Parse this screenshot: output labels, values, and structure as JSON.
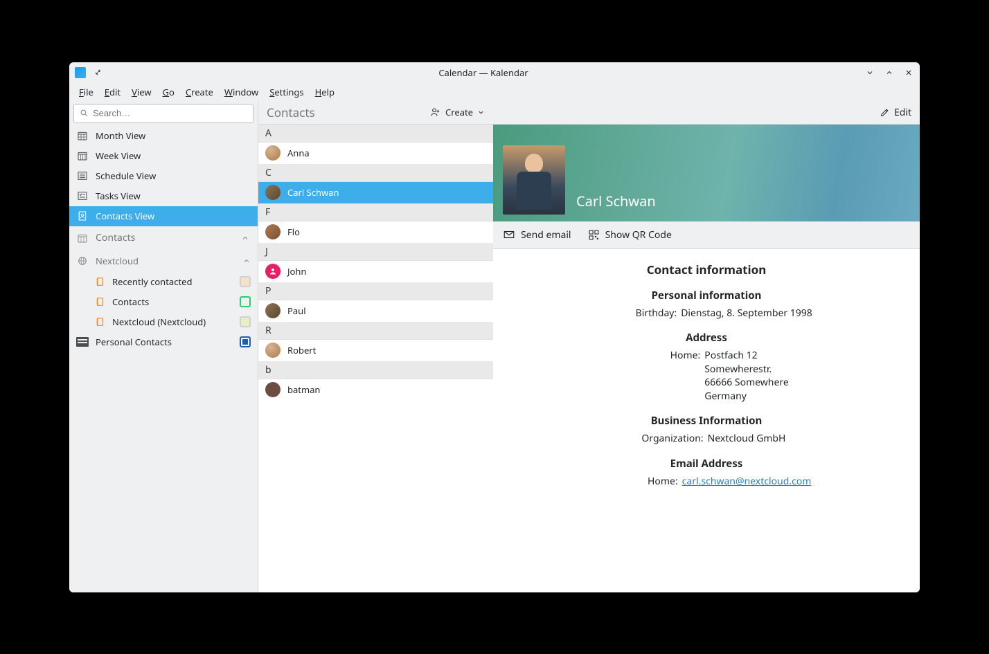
{
  "window": {
    "title": "Calendar — Kalendar"
  },
  "menubar": [
    "File",
    "Edit",
    "View",
    "Go",
    "Create",
    "Window",
    "Settings",
    "Help"
  ],
  "search": {
    "placeholder": "Search…"
  },
  "sidebar_views": [
    {
      "id": "month",
      "label": "Month View"
    },
    {
      "id": "week",
      "label": "Week View"
    },
    {
      "id": "schedule",
      "label": "Schedule View"
    },
    {
      "id": "tasks",
      "label": "Tasks View"
    },
    {
      "id": "contacts",
      "label": "Contacts View",
      "selected": true
    }
  ],
  "sidebar_section": {
    "label": "Contacts"
  },
  "nextcloud_group": {
    "label": "Nextcloud"
  },
  "nextcloud_children": [
    {
      "label": "Recently contacted",
      "swatch": "#f7e2c7"
    },
    {
      "label": "Contacts",
      "swatch_border": "#2ecc71"
    },
    {
      "label": "Nextcloud (Nextcloud)",
      "swatch": "#e7efc5"
    }
  ],
  "personal_contacts": {
    "label": "Personal Contacts",
    "swatch_fill": "#1a5fb4",
    "swatch_border": "#1a5fb4"
  },
  "contacts_header": {
    "title": "Contacts",
    "create": "Create"
  },
  "contact_groups": [
    {
      "letter": "A",
      "items": [
        {
          "name": "Anna",
          "avatar": "person"
        }
      ]
    },
    {
      "letter": "C",
      "items": [
        {
          "name": "Carl Schwan",
          "avatar": "grad1",
          "selected": true
        }
      ]
    },
    {
      "letter": "F",
      "items": [
        {
          "name": "Flo",
          "avatar": "grad2"
        }
      ]
    },
    {
      "letter": "J",
      "items": [
        {
          "name": "John",
          "avatar": "pink",
          "glyph": "person"
        }
      ]
    },
    {
      "letter": "P",
      "items": [
        {
          "name": "Paul",
          "avatar": "grad1"
        }
      ]
    },
    {
      "letter": "R",
      "items": [
        {
          "name": "Robert",
          "avatar": "person"
        }
      ]
    },
    {
      "letter": "b",
      "items": [
        {
          "name": "batman",
          "avatar": "brown"
        }
      ]
    }
  ],
  "detail": {
    "edit": "Edit",
    "name": "Carl Schwan",
    "actions": {
      "send_email": "Send email",
      "show_qr": "Show QR Code"
    },
    "heading": "Contact information",
    "personal_heading": "Personal information",
    "birthday_label": "Birthday:",
    "birthday_value": "Dienstag, 8. September 1998",
    "address_heading": "Address",
    "address_label": "Home:",
    "address_lines": [
      "Postfach 12",
      "Somewherestr.",
      "66666 Somewhere",
      "Germany"
    ],
    "business_heading": "Business Information",
    "org_label": "Organization:",
    "org_value": "Nextcloud GmbH",
    "email_heading": "Email Address",
    "email_label": "Home:",
    "email_value": "carl.schwan@nextcloud.com"
  }
}
